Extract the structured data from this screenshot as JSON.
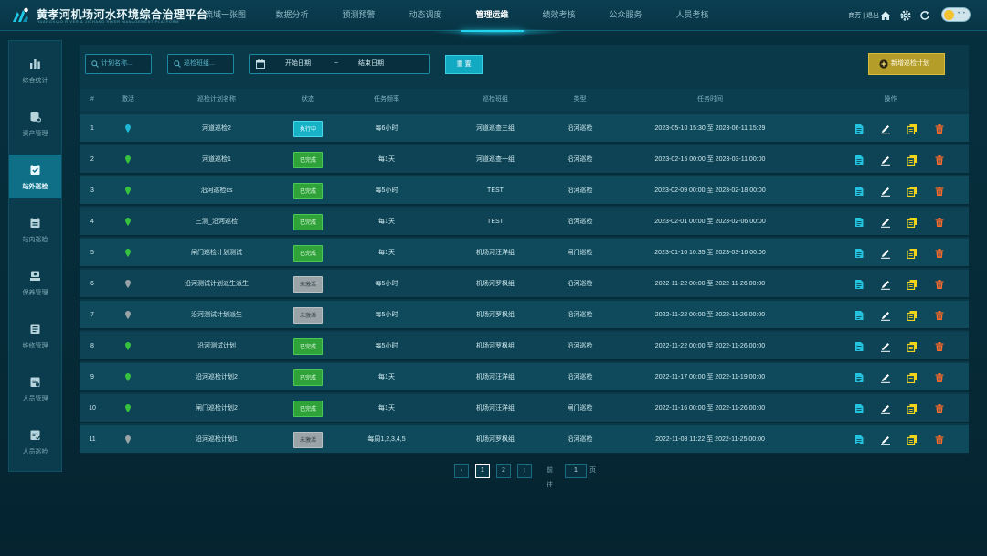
{
  "brand": {
    "title": "黄孝河机场河水环境综合治理平台",
    "subtitle": "HUANGXIAO RIVER & JICHANG RIVER MANAGEMENT PLATFORM"
  },
  "topnav": [
    {
      "label": "流域一张图",
      "active": false
    },
    {
      "label": "数据分析",
      "active": false
    },
    {
      "label": "预测预警",
      "active": false
    },
    {
      "label": "动态调度",
      "active": false
    },
    {
      "label": "管理运维",
      "active": true
    },
    {
      "label": "绩效考核",
      "active": false
    },
    {
      "label": "公众服务",
      "active": false
    },
    {
      "label": "人员考核",
      "active": false
    }
  ],
  "user": {
    "text": "商芳 | 退出"
  },
  "sidebar": [
    {
      "label": "综合统计",
      "icon": "bar-chart-icon",
      "active": false
    },
    {
      "label": "资产管理",
      "icon": "database-icon",
      "active": false
    },
    {
      "label": "站外巡检",
      "icon": "clipboard-check-icon",
      "active": true
    },
    {
      "label": "站内巡检",
      "icon": "clipboard-icon",
      "active": false
    },
    {
      "label": "保养管理",
      "icon": "maintenance-icon",
      "active": false
    },
    {
      "label": "维修管理",
      "icon": "repair-icon",
      "active": false
    },
    {
      "label": "人员管理",
      "icon": "staff-icon",
      "active": false
    },
    {
      "label": "人员巡检",
      "icon": "staff-inspect-icon",
      "active": false
    }
  ],
  "toolbar": {
    "plan_name_placeholder": "计划名称...",
    "team_placeholder": "巡检班组...",
    "date_start": "开始日期",
    "date_sep": "~",
    "date_end": "结束日期",
    "reset_label": "重 置",
    "add_label": "新增巡检计划"
  },
  "table": {
    "columns": [
      "#",
      "激活",
      "巡检计划名称",
      "状态",
      "任务频率",
      "巡检班组",
      "类型",
      "任务时间",
      "操作"
    ],
    "rows": [
      {
        "no": "1",
        "active": "blue",
        "name": "河道巡检2",
        "status": "执行中",
        "status_type": "exec",
        "freq": "每6小时",
        "team": "河道巡查三组",
        "type": "沿河巡检",
        "time": "2023-05-10 15:30 至 2023-06-11 15:29"
      },
      {
        "no": "2",
        "active": "green",
        "name": "河道巡检1",
        "status": "已完成",
        "status_type": "done",
        "freq": "每1天",
        "team": "河道巡查一组",
        "type": "沿河巡检",
        "time": "2023-02-15 00:00 至 2023-03-11 00:00"
      },
      {
        "no": "3",
        "active": "green",
        "name": "沿河巡检cs",
        "status": "已完成",
        "status_type": "done",
        "freq": "每5小时",
        "team": "TEST",
        "type": "沿河巡检",
        "time": "2023-02-09 00:00 至 2023-02-18 00:00"
      },
      {
        "no": "4",
        "active": "green",
        "name": "三测_沿河巡检",
        "status": "已完成",
        "status_type": "done",
        "freq": "每1天",
        "team": "TEST",
        "type": "沿河巡检",
        "time": "2023-02-01 00:00 至 2023-02-06 00:00"
      },
      {
        "no": "5",
        "active": "green",
        "name": "闸门巡检计划测试",
        "status": "已完成",
        "status_type": "done",
        "freq": "每1天",
        "team": "机场河汪洋组",
        "type": "闸门巡检",
        "time": "2023-01-16 10:35 至 2023-03-16 00:00"
      },
      {
        "no": "6",
        "active": "gray",
        "name": "沿河测试计划派生派生",
        "status": "未激活",
        "status_type": "idle",
        "freq": "每5小时",
        "team": "机场河罗枫组",
        "type": "沿河巡检",
        "time": "2022-11-22 00:00 至 2022-11-26 00:00"
      },
      {
        "no": "7",
        "active": "gray",
        "name": "沿河测试计划派生",
        "status": "未激活",
        "status_type": "idle",
        "freq": "每5小时",
        "team": "机场河罗枫组",
        "type": "沿河巡检",
        "time": "2022-11-22 00:00 至 2022-11-26 00:00"
      },
      {
        "no": "8",
        "active": "green",
        "name": "沿河测试计划",
        "status": "已完成",
        "status_type": "done",
        "freq": "每5小时",
        "team": "机场河罗枫组",
        "type": "沿河巡检",
        "time": "2022-11-22 00:00 至 2022-11-26 00:00"
      },
      {
        "no": "9",
        "active": "green",
        "name": "沿河巡检计划2",
        "status": "已完成",
        "status_type": "done",
        "freq": "每1天",
        "team": "机场河汪洋组",
        "type": "沿河巡检",
        "time": "2022-11-17 00:00 至 2022-11-19 00:00"
      },
      {
        "no": "10",
        "active": "green",
        "name": "闸门巡检计划2",
        "status": "已完成",
        "status_type": "done",
        "freq": "每1天",
        "team": "机场河汪洋组",
        "type": "闸门巡检",
        "time": "2022-11-16 00:00 至 2022-11-26 00:00"
      },
      {
        "no": "11",
        "active": "gray",
        "name": "沿河巡检计划1",
        "status": "未激活",
        "status_type": "idle",
        "freq": "每周1,2,3,4,5",
        "team": "机场河罗枫组",
        "type": "沿河巡检",
        "time": "2022-11-08 11:22 至 2022-11-25 00:00"
      }
    ]
  },
  "pagination": {
    "prev": "‹",
    "next": "›",
    "pages": [
      "1",
      "2"
    ],
    "current": "1",
    "goto_label": "前往",
    "goto_value": "1",
    "page_unit": "页"
  },
  "colors": {
    "accent": "#23d4ee",
    "pin_blue": "#1fb6d6",
    "pin_green": "#36c23f",
    "pin_gray": "#9aa4a7",
    "view": "#23c2de",
    "edit": "#ffffff",
    "copy": "#f2d21a",
    "delete": "#ff6a2a"
  }
}
